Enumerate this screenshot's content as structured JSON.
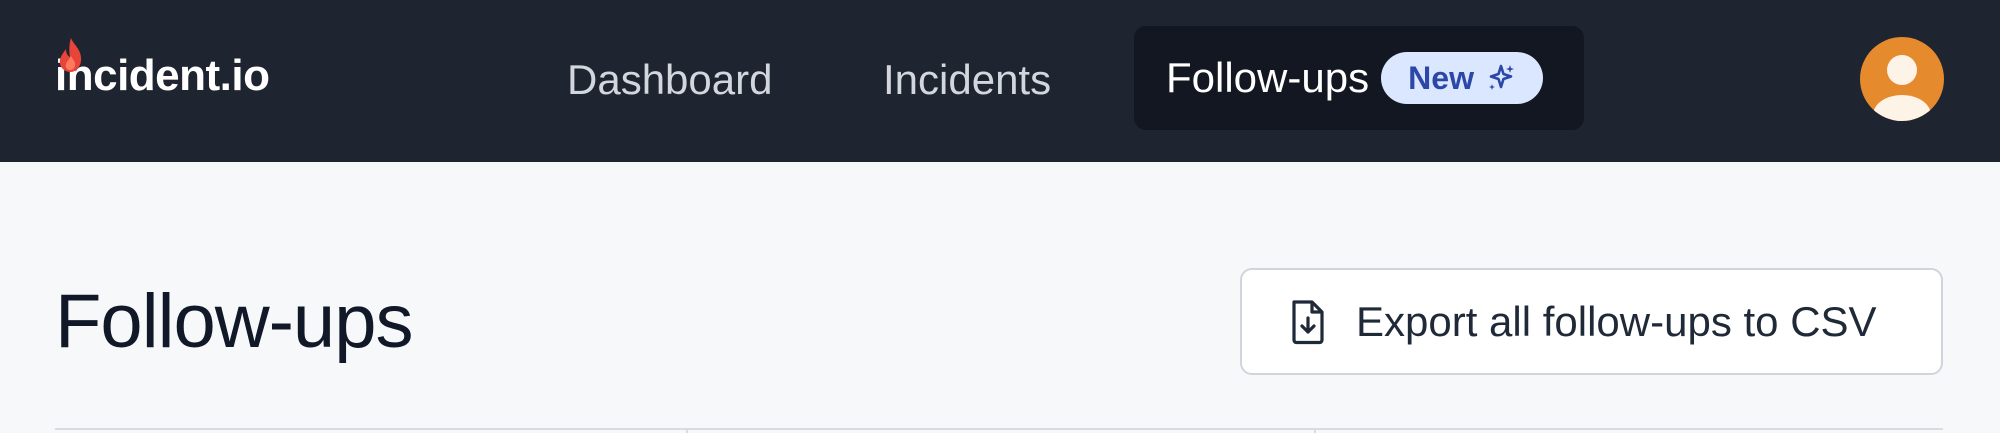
{
  "header": {
    "logo_text": "incident.io",
    "nav": {
      "dashboard": "Dashboard",
      "incidents": "Incidents",
      "followups": "Follow-ups",
      "new_badge": "New"
    }
  },
  "main": {
    "title": "Follow-ups",
    "export_button": "Export all follow-ups to CSV"
  },
  "colors": {
    "topbar": "#1f2431",
    "active_nav": "#131722",
    "badge_bg": "#dbe7ff",
    "badge_text": "#2b47a8",
    "flame": "#e8443a",
    "avatar": "#e68a2e"
  },
  "icons": {
    "logo": "flame-icon",
    "badge": "sparkles-icon",
    "avatar": "user-avatar-icon",
    "export": "file-download-icon"
  }
}
